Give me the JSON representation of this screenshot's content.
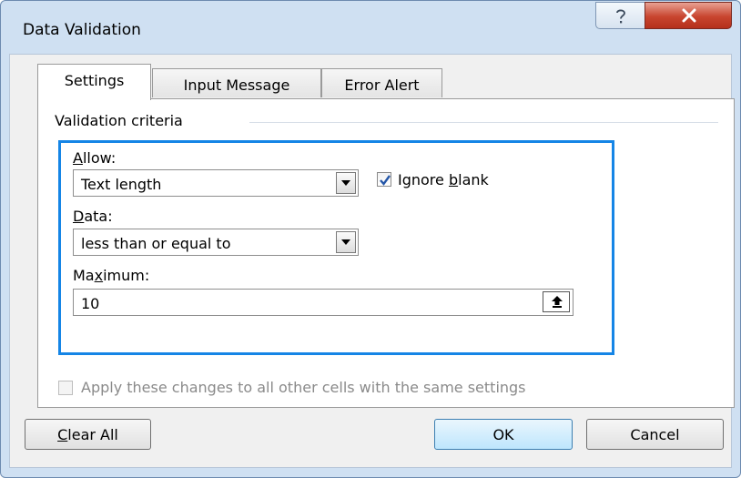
{
  "window": {
    "title": "Data Validation"
  },
  "titlebar": {
    "help_icon": "question-mark-icon",
    "close_icon": "close-x-icon"
  },
  "tabs": [
    {
      "label": "Settings",
      "active": true
    },
    {
      "label": "Input Message",
      "active": false
    },
    {
      "label": "Error Alert",
      "active": false
    }
  ],
  "criteria": {
    "group_label": "Validation criteria",
    "allow": {
      "label_prefix": "",
      "label_accel": "A",
      "label_rest": "llow:",
      "value": "Text length"
    },
    "ignore_blank": {
      "label_prefix": "Ignore ",
      "label_accel": "b",
      "label_rest": "lank",
      "checked": true
    },
    "data": {
      "label_prefix": "",
      "label_accel": "D",
      "label_rest": "ata:",
      "value": "less than or equal to"
    },
    "maximum": {
      "label_prefix": "Ma",
      "label_accel": "x",
      "label_rest": "imum:",
      "value": "10",
      "collapse_icon": "collapse-dialog-arrow-icon"
    },
    "highlight_color": "#1585e6"
  },
  "apply_all": {
    "label": "Apply these changes to all other cells with the same settings",
    "checked": false,
    "enabled": false
  },
  "buttons": {
    "clear_all": {
      "accel": "C",
      "rest": "lear All"
    },
    "ok": "OK",
    "cancel": "Cancel"
  }
}
